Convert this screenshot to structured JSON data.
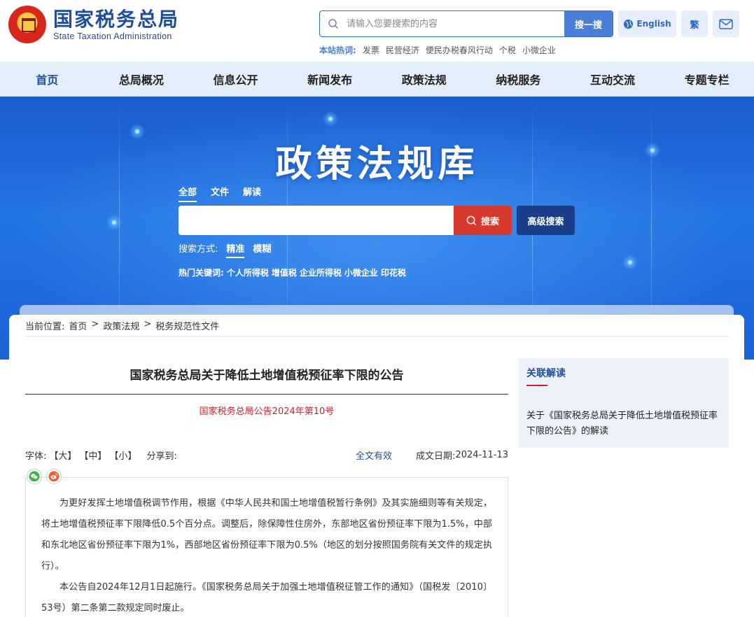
{
  "header": {
    "logo_cn": "国家税务总局",
    "logo_en": "State Taxation Administration",
    "search_placeholder": "请输入您要搜索的内容",
    "search_button": "搜一搜",
    "english_button": "English",
    "traditional_button": "繁",
    "hotwords_label": "本站热词:",
    "hotwords": [
      "发票",
      "民营经济",
      "便民办税春风行动",
      "个税",
      "小微企业"
    ]
  },
  "nav": {
    "items": [
      "首页",
      "总局概况",
      "信息公开",
      "新闻发布",
      "政策法规",
      "纳税服务",
      "互动交流",
      "专题专栏"
    ]
  },
  "banner": {
    "title": "政策法规库",
    "tabs": [
      "全部",
      "文件",
      "解读"
    ],
    "search_button": "搜索",
    "advanced_button": "高级搜索",
    "mode_label": "搜索方式:",
    "mode_options": [
      "精准",
      "模糊"
    ],
    "hot_label": "热门关键词:",
    "hot_keywords": [
      "个人所得税",
      "增值税",
      "企业所得税",
      "小微企业",
      "印花税"
    ]
  },
  "breadcrumb": {
    "label": "当前位置:",
    "items": [
      "首页",
      "政策法规",
      "税务规范性文件"
    ],
    "separator": ">"
  },
  "document": {
    "title": "国家税务总局关于降低土地增值税预征率下限的公告",
    "number": "国家税务总局公告2024年第10号",
    "font_label": "字体:",
    "font_sizes": [
      "【大】",
      "【中】",
      "【小】"
    ],
    "share_label": "分享到:",
    "validity": "全文有效",
    "date_label": "成文日期:",
    "date": "2024-11-13",
    "paragraphs": [
      "为更好发挥土地增值税调节作用，根据《中华人民共和国土地增值税暂行条例》及其实施细则等有关规定，将土地增值税预征率下限降低0.5个百分点。调整后，除保障性住房外，东部地区省份预征率下限为1.5%，中部和东北地区省份预征率下限为1%，西部地区省份预征率下限为0.5%（地区的划分按照国务院有关文件的规定执行）。",
      "本公告自2024年12月1日起施行。《国家税务总局关于加强土地增值税征管工作的通知》（国税发〔2010〕53号）第二条第二款规定同时废止。"
    ]
  },
  "sidebar": {
    "title": "关联解读",
    "link": "关于《国家税务总局关于降低土地增值税预征率下限的公告》的解读"
  },
  "colors": {
    "brand_blue": "#1f4e9e",
    "accent_red": "#d0202a",
    "nav_bg": "#e3eefb"
  }
}
